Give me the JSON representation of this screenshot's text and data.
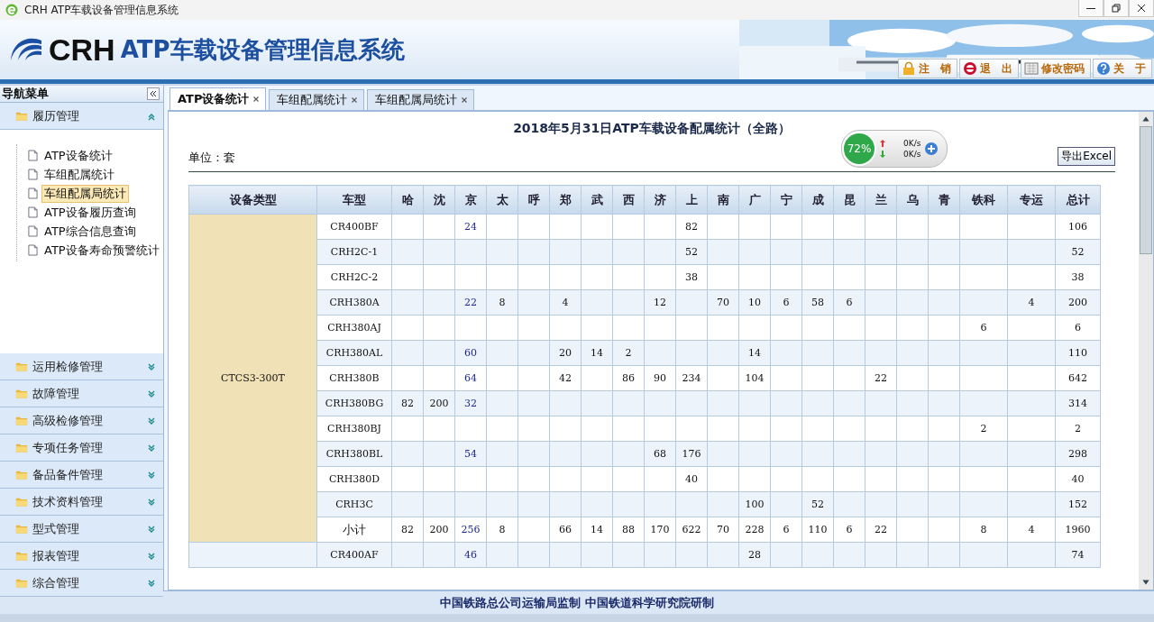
{
  "window": {
    "title": "CRH ATP车载设备管理信息系统"
  },
  "header": {
    "logo": "CRH",
    "system_name": "ATP车载设备管理信息系统",
    "buttons": [
      {
        "label": "注　销",
        "kind": "lock"
      },
      {
        "label": "退　出",
        "kind": "exit"
      },
      {
        "label": "修改密码",
        "kind": "keyboard"
      },
      {
        "label": "关　于",
        "kind": "help"
      }
    ]
  },
  "sidebar": {
    "title": "导航菜单",
    "groups": [
      {
        "label": "履历管理",
        "expanded": true,
        "children": [
          {
            "label": "ATP设备统计",
            "selected": false
          },
          {
            "label": "车组配属统计",
            "selected": false
          },
          {
            "label": "车组配属局统计",
            "selected": true
          },
          {
            "label": "ATP设备履历查询",
            "selected": false
          },
          {
            "label": "ATP综合信息查询",
            "selected": false
          },
          {
            "label": "ATP设备寿命预警统计",
            "selected": false
          }
        ]
      },
      {
        "label": "运用检修管理",
        "expanded": false
      },
      {
        "label": "故障管理",
        "expanded": false
      },
      {
        "label": "高级检修管理",
        "expanded": false
      },
      {
        "label": "专项任务管理",
        "expanded": false
      },
      {
        "label": "备品备件管理",
        "expanded": false
      },
      {
        "label": "技术资料管理",
        "expanded": false
      },
      {
        "label": "型式管理",
        "expanded": false
      },
      {
        "label": "报表管理",
        "expanded": false
      },
      {
        "label": "综合管理",
        "expanded": false
      }
    ]
  },
  "tabs": [
    {
      "label": "ATP设备统计",
      "selected": true
    },
    {
      "label": "车组配属统计",
      "selected": false
    },
    {
      "label": "车组配属局统计",
      "selected": false
    }
  ],
  "report": {
    "title": "2018年5月31日ATP车载设备配属统计（全路）",
    "unit": "单位：套",
    "export_button": "导出Excel"
  },
  "speed_widget": {
    "percent": "72%",
    "upload": "0K/s",
    "download": "0K/s"
  },
  "table": {
    "columns": [
      {
        "label": "设备类型",
        "kind": "group"
      },
      {
        "label": "车型",
        "kind": "model"
      },
      {
        "label": "哈",
        "kind": "region"
      },
      {
        "label": "沈",
        "kind": "region"
      },
      {
        "label": "京",
        "kind": "region",
        "link": true
      },
      {
        "label": "太",
        "kind": "region"
      },
      {
        "label": "呼",
        "kind": "region"
      },
      {
        "label": "郑",
        "kind": "region"
      },
      {
        "label": "武",
        "kind": "region"
      },
      {
        "label": "西",
        "kind": "region"
      },
      {
        "label": "济",
        "kind": "region"
      },
      {
        "label": "上",
        "kind": "region"
      },
      {
        "label": "南",
        "kind": "region"
      },
      {
        "label": "广",
        "kind": "region"
      },
      {
        "label": "宁",
        "kind": "region"
      },
      {
        "label": "成",
        "kind": "region"
      },
      {
        "label": "昆",
        "kind": "region"
      },
      {
        "label": "兰",
        "kind": "region"
      },
      {
        "label": "乌",
        "kind": "region"
      },
      {
        "label": "青",
        "kind": "region"
      },
      {
        "label": "铁科",
        "kind": "wide"
      },
      {
        "label": "专运",
        "kind": "wide"
      },
      {
        "label": "总计",
        "kind": "total"
      }
    ],
    "groups": [
      {
        "name": "CTCS3-300T",
        "rows": [
          {
            "model": "CR400BF",
            "kind": "model",
            "cells": [
              {
                "blank": true
              },
              {
                "blank": true
              },
              {
                "text": "24"
              },
              {
                "blank": true
              },
              {
                "blank": true
              },
              {
                "blank": true
              },
              {
                "blank": true
              },
              {
                "blank": true
              },
              {
                "blank": true
              },
              {
                "text": "82"
              },
              {
                "blank": true
              },
              {
                "blank": true
              },
              {
                "blank": true
              },
              {
                "blank": true
              },
              {
                "blank": true
              },
              {
                "blank": true
              },
              {
                "blank": true
              },
              {
                "blank": true
              },
              {
                "blank": true
              },
              {
                "blank": true
              },
              {
                "text": "106"
              }
            ]
          },
          {
            "model": "CRH2C-1",
            "kind": "model",
            "cells": [
              {
                "blank": true
              },
              {
                "blank": true
              },
              {
                "blank": true
              },
              {
                "blank": true
              },
              {
                "blank": true
              },
              {
                "blank": true
              },
              {
                "blank": true
              },
              {
                "blank": true
              },
              {
                "blank": true
              },
              {
                "text": "52"
              },
              {
                "blank": true
              },
              {
                "blank": true
              },
              {
                "blank": true
              },
              {
                "blank": true
              },
              {
                "blank": true
              },
              {
                "blank": true
              },
              {
                "blank": true
              },
              {
                "blank": true
              },
              {
                "blank": true
              },
              {
                "blank": true
              },
              {
                "text": "52"
              }
            ]
          },
          {
            "model": "CRH2C-2",
            "kind": "model",
            "cells": [
              {
                "blank": true
              },
              {
                "blank": true
              },
              {
                "blank": true
              },
              {
                "blank": true
              },
              {
                "blank": true
              },
              {
                "blank": true
              },
              {
                "blank": true
              },
              {
                "blank": true
              },
              {
                "blank": true
              },
              {
                "text": "38"
              },
              {
                "blank": true
              },
              {
                "blank": true
              },
              {
                "blank": true
              },
              {
                "blank": true
              },
              {
                "blank": true
              },
              {
                "blank": true
              },
              {
                "blank": true
              },
              {
                "blank": true
              },
              {
                "blank": true
              },
              {
                "blank": true
              },
              {
                "text": "38"
              }
            ]
          },
          {
            "model": "CRH380A",
            "kind": "model",
            "cells": [
              {
                "blank": true
              },
              {
                "blank": true
              },
              {
                "text": "22"
              },
              {
                "text": "8"
              },
              {
                "blank": true
              },
              {
                "text": "4"
              },
              {
                "blank": true
              },
              {
                "blank": true
              },
              {
                "text": "12"
              },
              {
                "blank": true
              },
              {
                "text": "70"
              },
              {
                "text": "10"
              },
              {
                "text": "6"
              },
              {
                "text": "58"
              },
              {
                "text": "6"
              },
              {
                "blank": true
              },
              {
                "blank": true
              },
              {
                "blank": true
              },
              {
                "blank": true
              },
              {
                "text": "4"
              },
              {
                "text": "200"
              }
            ]
          },
          {
            "model": "CRH380AJ",
            "kind": "model",
            "cells": [
              {
                "blank": true
              },
              {
                "blank": true
              },
              {
                "blank": true
              },
              {
                "blank": true
              },
              {
                "blank": true
              },
              {
                "blank": true
              },
              {
                "blank": true
              },
              {
                "blank": true
              },
              {
                "blank": true
              },
              {
                "blank": true
              },
              {
                "blank": true
              },
              {
                "blank": true
              },
              {
                "blank": true
              },
              {
                "blank": true
              },
              {
                "blank": true
              },
              {
                "blank": true
              },
              {
                "blank": true
              },
              {
                "blank": true
              },
              {
                "text": "6"
              },
              {
                "blank": true
              },
              {
                "text": "6"
              }
            ]
          },
          {
            "model": "CRH380AL",
            "kind": "model",
            "cells": [
              {
                "blank": true
              },
              {
                "blank": true
              },
              {
                "text": "60"
              },
              {
                "blank": true
              },
              {
                "blank": true
              },
              {
                "text": "20"
              },
              {
                "text": "14"
              },
              {
                "text": "2"
              },
              {
                "blank": true
              },
              {
                "blank": true
              },
              {
                "blank": true
              },
              {
                "text": "14"
              },
              {
                "blank": true
              },
              {
                "blank": true
              },
              {
                "blank": true
              },
              {
                "blank": true
              },
              {
                "blank": true
              },
              {
                "blank": true
              },
              {
                "blank": true
              },
              {
                "blank": true
              },
              {
                "text": "110"
              }
            ]
          },
          {
            "model": "CRH380B",
            "kind": "model",
            "cells": [
              {
                "blank": true
              },
              {
                "blank": true
              },
              {
                "text": "64"
              },
              {
                "blank": true
              },
              {
                "blank": true
              },
              {
                "text": "42"
              },
              {
                "blank": true
              },
              {
                "text": "86"
              },
              {
                "text": "90"
              },
              {
                "text": "234"
              },
              {
                "blank": true
              },
              {
                "text": "104"
              },
              {
                "blank": true
              },
              {
                "blank": true
              },
              {
                "blank": true
              },
              {
                "text": "22"
              },
              {
                "blank": true
              },
              {
                "blank": true
              },
              {
                "blank": true
              },
              {
                "blank": true
              },
              {
                "text": "642"
              }
            ]
          },
          {
            "model": "CRH380BG",
            "kind": "model",
            "cells": [
              {
                "text": "82"
              },
              {
                "text": "200"
              },
              {
                "text": "32"
              },
              {
                "blank": true
              },
              {
                "blank": true
              },
              {
                "blank": true
              },
              {
                "blank": true
              },
              {
                "blank": true
              },
              {
                "blank": true
              },
              {
                "blank": true
              },
              {
                "blank": true
              },
              {
                "blank": true
              },
              {
                "blank": true
              },
              {
                "blank": true
              },
              {
                "blank": true
              },
              {
                "blank": true
              },
              {
                "blank": true
              },
              {
                "blank": true
              },
              {
                "blank": true
              },
              {
                "blank": true
              },
              {
                "text": "314"
              }
            ]
          },
          {
            "model": "CRH380BJ",
            "kind": "model",
            "cells": [
              {
                "blank": true
              },
              {
                "blank": true
              },
              {
                "blank": true
              },
              {
                "blank": true
              },
              {
                "blank": true
              },
              {
                "blank": true
              },
              {
                "blank": true
              },
              {
                "blank": true
              },
              {
                "blank": true
              },
              {
                "blank": true
              },
              {
                "blank": true
              },
              {
                "blank": true
              },
              {
                "blank": true
              },
              {
                "blank": true
              },
              {
                "blank": true
              },
              {
                "blank": true
              },
              {
                "blank": true
              },
              {
                "blank": true
              },
              {
                "text": "2"
              },
              {
                "blank": true
              },
              {
                "text": "2"
              }
            ]
          },
          {
            "model": "CRH380BL",
            "kind": "model",
            "cells": [
              {
                "blank": true
              },
              {
                "blank": true
              },
              {
                "text": "54"
              },
              {
                "blank": true
              },
              {
                "blank": true
              },
              {
                "blank": true
              },
              {
                "blank": true
              },
              {
                "blank": true
              },
              {
                "text": "68"
              },
              {
                "text": "176"
              },
              {
                "blank": true
              },
              {
                "blank": true
              },
              {
                "blank": true
              },
              {
                "blank": true
              },
              {
                "blank": true
              },
              {
                "blank": true
              },
              {
                "blank": true
              },
              {
                "blank": true
              },
              {
                "blank": true
              },
              {
                "blank": true
              },
              {
                "text": "298"
              }
            ]
          },
          {
            "model": "CRH380D",
            "kind": "model",
            "cells": [
              {
                "blank": true
              },
              {
                "blank": true
              },
              {
                "blank": true
              },
              {
                "blank": true
              },
              {
                "blank": true
              },
              {
                "blank": true
              },
              {
                "blank": true
              },
              {
                "blank": true
              },
              {
                "blank": true
              },
              {
                "text": "40"
              },
              {
                "blank": true
              },
              {
                "blank": true
              },
              {
                "blank": true
              },
              {
                "blank": true
              },
              {
                "blank": true
              },
              {
                "blank": true
              },
              {
                "blank": true
              },
              {
                "blank": true
              },
              {
                "blank": true
              },
              {
                "blank": true
              },
              {
                "text": "40"
              }
            ]
          },
          {
            "model": "CRH3C",
            "kind": "model",
            "cells": [
              {
                "blank": true
              },
              {
                "blank": true
              },
              {
                "blank": true
              },
              {
                "blank": true
              },
              {
                "blank": true
              },
              {
                "blank": true
              },
              {
                "blank": true
              },
              {
                "blank": true
              },
              {
                "blank": true
              },
              {
                "blank": true
              },
              {
                "blank": true
              },
              {
                "text": "100"
              },
              {
                "blank": true
              },
              {
                "text": "52"
              },
              {
                "blank": true
              },
              {
                "blank": true
              },
              {
                "blank": true
              },
              {
                "blank": true
              },
              {
                "blank": true
              },
              {
                "blank": true
              },
              {
                "text": "152"
              }
            ]
          },
          {
            "model": "小计",
            "kind": "subtotal",
            "cells": [
              {
                "text": "82"
              },
              {
                "text": "200"
              },
              {
                "text": "256"
              },
              {
                "text": "8"
              },
              {
                "blank": true
              },
              {
                "text": "66"
              },
              {
                "text": "14"
              },
              {
                "text": "88"
              },
              {
                "text": "170"
              },
              {
                "text": "622"
              },
              {
                "text": "70"
              },
              {
                "text": "228"
              },
              {
                "text": "6"
              },
              {
                "text": "110"
              },
              {
                "text": "6"
              },
              {
                "text": "22"
              },
              {
                "blank": true
              },
              {
                "blank": true
              },
              {
                "text": "8"
              },
              {
                "text": "4"
              },
              {
                "text": "1960"
              }
            ]
          }
        ]
      },
      {
        "rows": [
          {
            "model": "CR400AF",
            "kind": "model",
            "cells": [
              {
                "blank": true
              },
              {
                "blank": true
              },
              {
                "text": "46"
              },
              {
                "blank": true
              },
              {
                "blank": true
              },
              {
                "blank": true
              },
              {
                "blank": true
              },
              {
                "blank": true
              },
              {
                "blank": true
              },
              {
                "blank": true
              },
              {
                "blank": true
              },
              {
                "text": "28"
              },
              {
                "blank": true
              },
              {
                "blank": true
              },
              {
                "blank": true
              },
              {
                "blank": true
              },
              {
                "blank": true
              },
              {
                "blank": true
              },
              {
                "blank": true
              },
              {
                "blank": true
              },
              {
                "text": "74"
              }
            ]
          }
        ]
      }
    ]
  },
  "footer": "中国铁路总公司运输局监制 中国铁道科学研究院研制"
}
